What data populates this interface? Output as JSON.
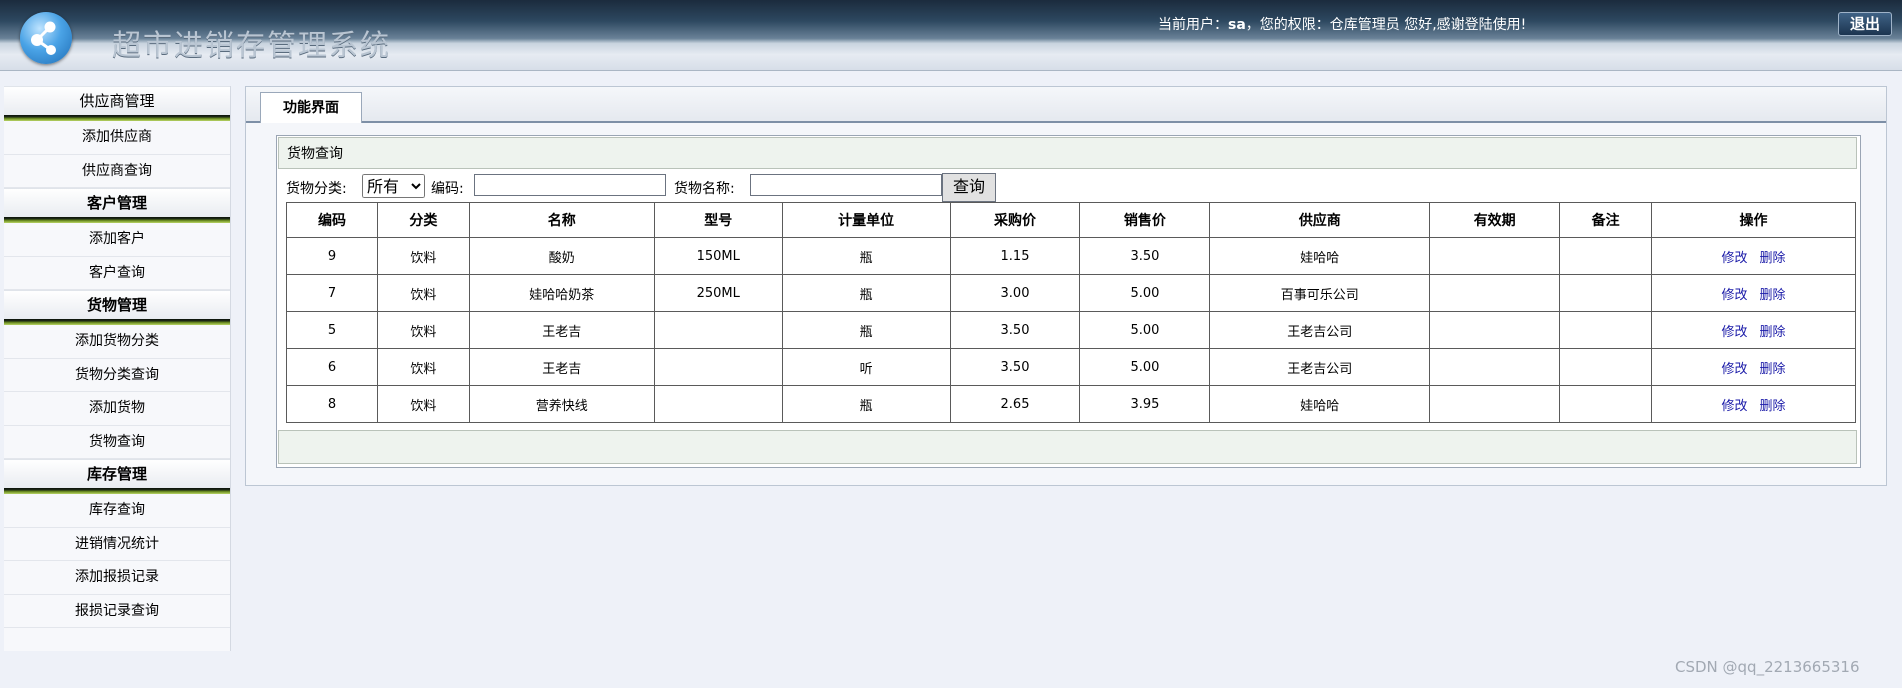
{
  "header": {
    "app_title": "超市进销存管理系统",
    "user_prefix": "当前用户：",
    "username": "sa",
    "role_text": "，您的权限：仓库管理员 您好,感谢登陆使用!",
    "logout_label": "退出"
  },
  "sidebar": {
    "groups": [
      {
        "title": "供应商管理",
        "items": [
          "添加供应商",
          "供应商查询"
        ]
      },
      {
        "title": "客户管理",
        "items": [
          "添加客户",
          "客户查询"
        ]
      },
      {
        "title": "货物管理",
        "items": [
          "添加货物分类",
          "货物分类查询",
          "添加货物",
          "货物查询"
        ]
      },
      {
        "title": "库存管理",
        "items": [
          "库存查询",
          "进销情况统计",
          "添加报损记录",
          "报损记录查询"
        ]
      }
    ]
  },
  "main": {
    "tab_label": "功能界面",
    "panel_title": "货物查询",
    "form": {
      "category_label": "货物分类:",
      "category_value": "所有",
      "code_label": "编码:",
      "code_value": "",
      "name_label": "货物名称:",
      "name_value": "",
      "search_label": "查询"
    },
    "table": {
      "columns": [
        "编码",
        "分类",
        "名称",
        "型号",
        "计量单位",
        "采购价",
        "销售价",
        "供应商",
        "有效期",
        "备注",
        "操作"
      ],
      "rows": [
        [
          "9",
          "饮料",
          "酸奶",
          "150ML",
          "瓶",
          "1.15",
          "3.50",
          "娃哈哈",
          "",
          ""
        ],
        [
          "7",
          "饮料",
          "娃哈哈奶茶",
          "250ML",
          "瓶",
          "3.00",
          "5.00",
          "百事可乐公司",
          "",
          ""
        ],
        [
          "5",
          "饮料",
          "王老吉",
          "",
          "瓶",
          "3.50",
          "5.00",
          "王老吉公司",
          "",
          ""
        ],
        [
          "6",
          "饮料",
          "王老吉",
          "",
          "听",
          "3.50",
          "5.00",
          "王老吉公司",
          "",
          ""
        ],
        [
          "8",
          "饮料",
          "营养快线",
          "",
          "瓶",
          "2.65",
          "3.95",
          "娃哈哈",
          "",
          ""
        ]
      ],
      "edit_label": "修改",
      "delete_label": "删除"
    }
  },
  "watermark": "CSDN @qq_2213665316",
  "colors": {
    "link": "#1a1aa8",
    "accent_bar": "#6d8f22",
    "header_dark": "#1b2b3d"
  }
}
